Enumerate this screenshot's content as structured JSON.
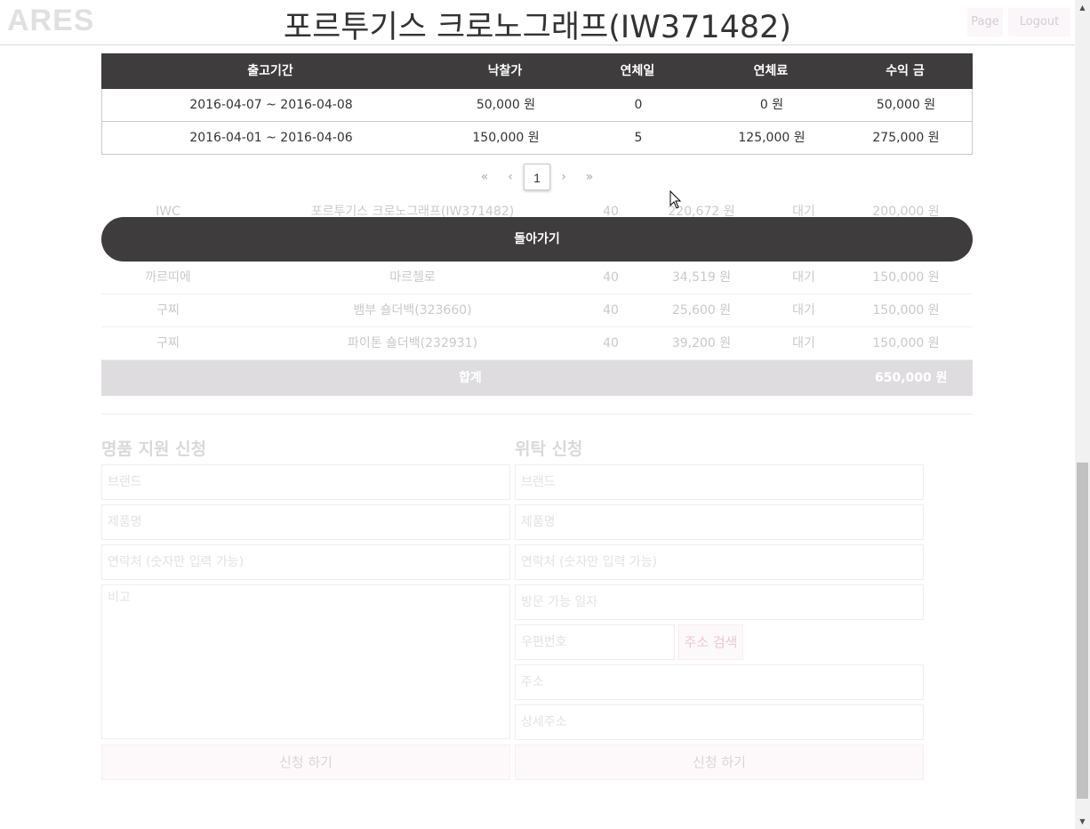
{
  "header": {
    "logo": "ARES",
    "links": [
      "Page",
      "Logout"
    ]
  },
  "modal": {
    "title": "포르투기스 크로노그래프(IW371482)",
    "columns": [
      "출고기간",
      "낙찰가",
      "연체일",
      "연체료",
      "수익 금"
    ],
    "rows": [
      {
        "period": "2016-04-07 ~ 2016-04-08",
        "bid": "50,000 원",
        "late_days": "0",
        "late_fee": "0 원",
        "revenue": "50,000 원"
      },
      {
        "period": "2016-04-01 ~ 2016-04-06",
        "bid": "150,000 원",
        "late_days": "5",
        "late_fee": "125,000 원",
        "revenue": "275,000 원"
      }
    ],
    "pagination": {
      "first": "«",
      "prev": "‹",
      "current": "1",
      "next": "›",
      "last": "»"
    },
    "back_label": "돌아가기"
  },
  "background_table": {
    "rows": [
      {
        "brand": "IWC",
        "name": "포르투기스 크로노그래프(IW371482)",
        "days": "40",
        "price": "220,672 원",
        "state": "대기",
        "total": "200,000 원"
      },
      {
        "brand": "까르띠에",
        "name": "마르첼로",
        "days": "40",
        "price": "34,519 원",
        "state": "대기",
        "total": "150,000 원"
      },
      {
        "brand": "구찌",
        "name": "뱀부 숄더백(323660)",
        "days": "40",
        "price": "25,600 원",
        "state": "대기",
        "total": "150,000 원"
      },
      {
        "brand": "구찌",
        "name": "파이톤 숄더백(232931)",
        "days": "40",
        "price": "39,200 원",
        "state": "대기",
        "total": "150,000 원"
      }
    ],
    "sum_label": "합계",
    "sum_value": "650,000 원"
  },
  "support_form": {
    "title": "명품 지원 신청",
    "brand_placeholder": "브랜드",
    "product_placeholder": "제품명",
    "phone_placeholder": "연락처 (숫자만 입력 가능)",
    "memo_placeholder": "비고",
    "submit_label": "신청 하기"
  },
  "consign_form": {
    "title": "위탁 신청",
    "brand_placeholder": "브랜드",
    "product_placeholder": "제품명",
    "phone_placeholder": "연락처 (숫자만 입력 가능)",
    "visit_placeholder": "방문 가능 일자",
    "zip_placeholder": "우편번호",
    "address_search_label": "주소 검색",
    "address_placeholder": "주소",
    "address_detail_placeholder": "상세주소",
    "submit_label": "신청 하기"
  },
  "scrollbar": {
    "up_icon": "triangle-up",
    "down_icon": "triangle-down"
  }
}
